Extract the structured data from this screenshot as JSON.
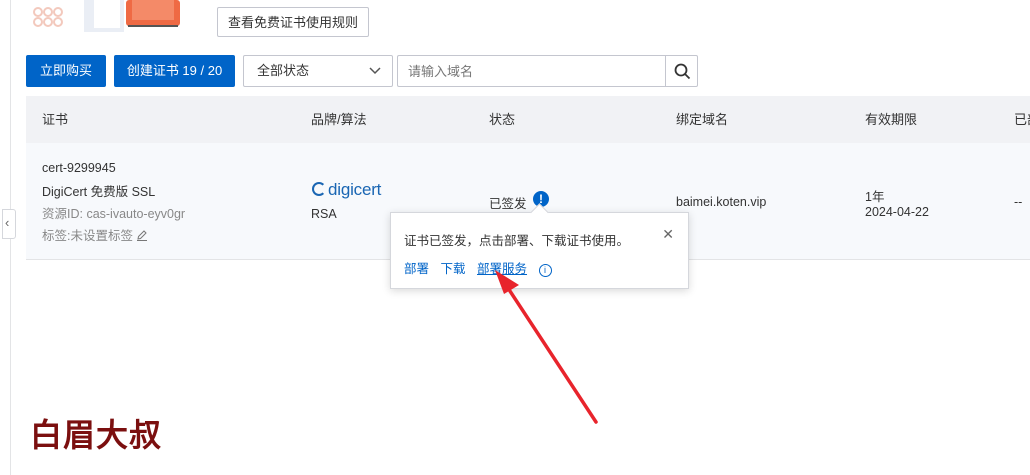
{
  "toolbar": {
    "rules_button": "查看免费证书使用规则",
    "buy_button": "立即购买",
    "create_button": "创建证书 19 / 20",
    "status_select_value": "全部状态",
    "search_placeholder": "请输入域名"
  },
  "table": {
    "columns": [
      "证书",
      "品牌/算法",
      "状态",
      "绑定域名",
      "有效期限",
      "已部"
    ],
    "row": {
      "cert_id": "cert-9299945",
      "cert_name": "DigiCert 免费版 SSL",
      "resource_id": "资源ID: cas-ivauto-eyv0gr",
      "tag": "标签:未设置标签",
      "brand": "digicert",
      "algorithm": "RSA",
      "status": "已签发",
      "domain": "baimei.koten.vip",
      "validity_period": "1年",
      "validity_date": "2024-04-22",
      "deployed": "--"
    }
  },
  "popover": {
    "message": "证书已签发，点击部署、下载证书使用。",
    "links": [
      "部署",
      "下载",
      "部署服务"
    ]
  },
  "watermark": "白眉大叔",
  "colors": {
    "primary": "#0064c8",
    "annotation_arrow": "#e8242c",
    "watermark": "#7b0f0f"
  }
}
